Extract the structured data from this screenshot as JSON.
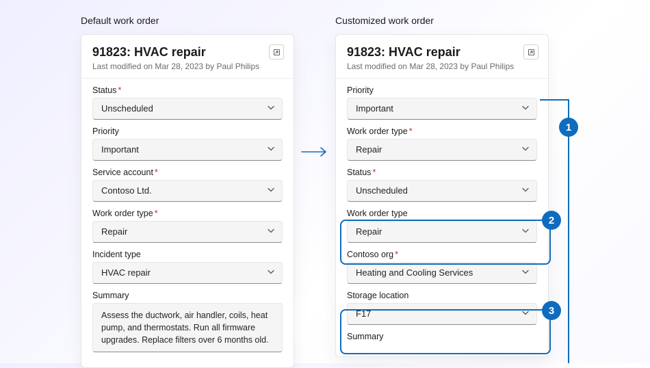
{
  "left": {
    "heading": "Default work order",
    "title": "91823: HVAC repair",
    "subtitle": "Last modified on Mar 28, 2023 by Paul Philips",
    "fields": {
      "status_label": "Status",
      "status_value": "Unscheduled",
      "priority_label": "Priority",
      "priority_value": "Important",
      "service_account_label": "Service account",
      "service_account_value": "Contoso Ltd.",
      "wo_type_label": "Work order type",
      "wo_type_value": "Repair",
      "incident_label": "Incident type",
      "incident_value": "HVAC repair",
      "summary_label": "Summary",
      "summary_value": "Assess the ductwork, air handler, coils, heat pump, and thermostats. Run all firmware upgrades. Replace filters over 6 months old."
    }
  },
  "right": {
    "heading": "Customized work order",
    "title": "91823: HVAC repair",
    "subtitle": "Last modified on Mar 28, 2023 by Paul Philips",
    "fields": {
      "priority_label": "Priority",
      "priority_value": "Important",
      "wo_type_label": "Work order type",
      "wo_type_value": "Repair",
      "status_label": "Status",
      "status_value": "Unscheduled",
      "wo_type2_label": "Work order type",
      "wo_type2_value": "Repair",
      "contoso_label": "Contoso org",
      "contoso_value": "Heating and Cooling Services",
      "storage_label": "Storage location",
      "storage_value": "F17",
      "summary_label": "Summary"
    }
  },
  "callouts": {
    "c1": "1",
    "c2": "2",
    "c3": "3"
  }
}
